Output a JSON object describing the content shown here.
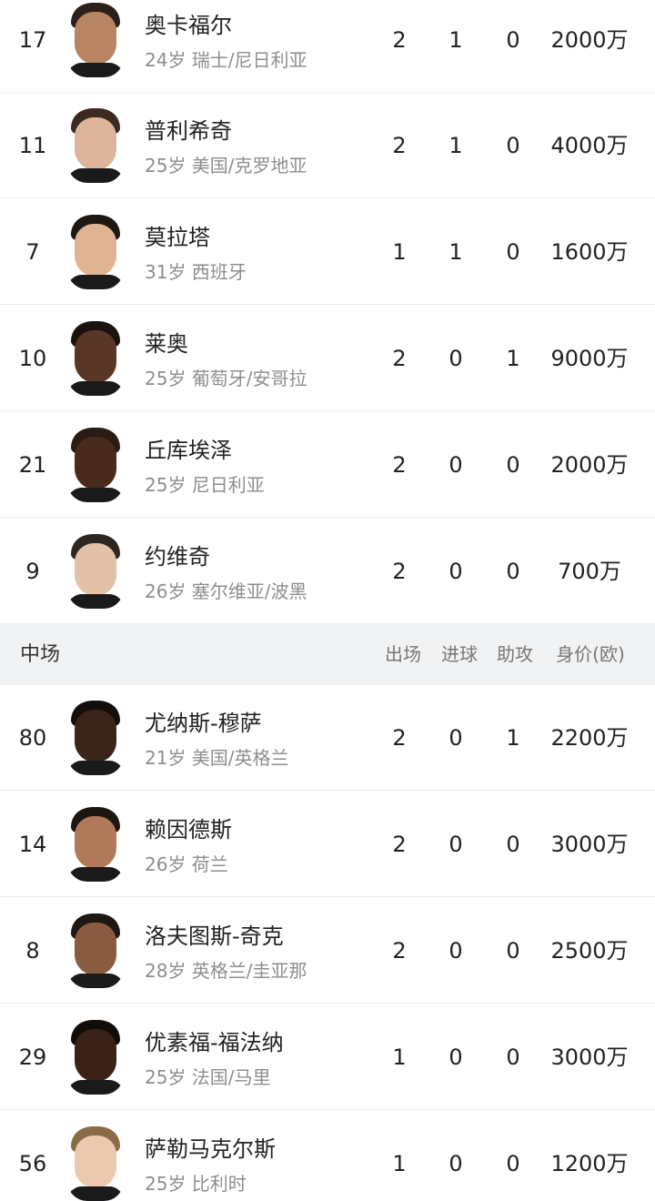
{
  "forwards": [
    {
      "number": "17",
      "name": "奥卡福尔",
      "meta": "24岁 瑞士/尼日利亚",
      "apps": "2",
      "goals": "1",
      "assists": "0",
      "value": "2000万"
    },
    {
      "number": "11",
      "name": "普利希奇",
      "meta": "25岁 美国/克罗地亚",
      "apps": "2",
      "goals": "1",
      "assists": "0",
      "value": "4000万"
    },
    {
      "number": "7",
      "name": "莫拉塔",
      "meta": "31岁 西班牙",
      "apps": "1",
      "goals": "1",
      "assists": "0",
      "value": "1600万"
    },
    {
      "number": "10",
      "name": "莱奥",
      "meta": "25岁 葡萄牙/安哥拉",
      "apps": "2",
      "goals": "0",
      "assists": "1",
      "value": "9000万"
    },
    {
      "number": "21",
      "name": "丘库埃泽",
      "meta": "25岁 尼日利亚",
      "apps": "2",
      "goals": "0",
      "assists": "0",
      "value": "2000万"
    },
    {
      "number": "9",
      "name": "约维奇",
      "meta": "26岁 塞尔维亚/波黑",
      "apps": "2",
      "goals": "0",
      "assists": "0",
      "value": "700万"
    }
  ],
  "midfield_header": {
    "title": "中场",
    "col_apps": "出场",
    "col_goals": "进球",
    "col_assists": "助攻",
    "col_value": "身价(欧)"
  },
  "midfielders": [
    {
      "number": "80",
      "name": "尤纳斯-穆萨",
      "meta": "21岁 美国/英格兰",
      "apps": "2",
      "goals": "0",
      "assists": "1",
      "value": "2200万"
    },
    {
      "number": "14",
      "name": "赖因德斯",
      "meta": "26岁 荷兰",
      "apps": "2",
      "goals": "0",
      "assists": "0",
      "value": "3000万"
    },
    {
      "number": "8",
      "name": "洛夫图斯-奇克",
      "meta": "28岁 英格兰/圭亚那",
      "apps": "2",
      "goals": "0",
      "assists": "0",
      "value": "2500万"
    },
    {
      "number": "29",
      "name": "优素福-福法纳",
      "meta": "25岁 法国/马里",
      "apps": "1",
      "goals": "0",
      "assists": "0",
      "value": "3000万"
    },
    {
      "number": "56",
      "name": "萨勒马克尔斯",
      "meta": "25岁 比利时",
      "apps": "1",
      "goals": "0",
      "assists": "0",
      "value": "1200万"
    }
  ],
  "colors": {
    "accent": "#3bbf6c",
    "section_bg": "#f1f2f4",
    "secondary_text": "#8e8e8e"
  }
}
